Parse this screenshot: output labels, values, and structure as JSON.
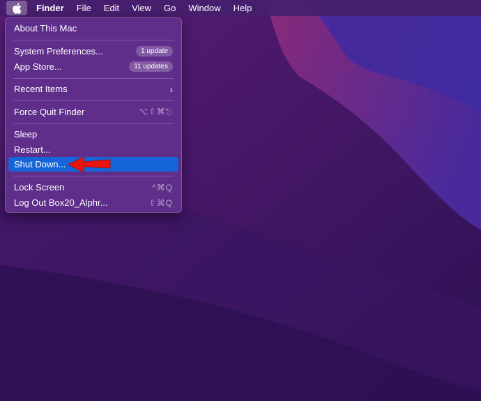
{
  "menubar": {
    "apple_icon": "apple-icon",
    "items": [
      "Finder",
      "File",
      "Edit",
      "View",
      "Go",
      "Window",
      "Help"
    ]
  },
  "apple_menu": {
    "about": "About This Mac",
    "system_preferences": {
      "label": "System Preferences...",
      "badge": "1 update"
    },
    "app_store": {
      "label": "App Store...",
      "badge": "11 updates"
    },
    "recent_items": {
      "label": "Recent Items",
      "icon": "chevron-right-icon"
    },
    "force_quit": {
      "label": "Force Quit Finder",
      "shortcut": "⌥⇧⌘⎋"
    },
    "sleep": "Sleep",
    "restart": "Restart...",
    "shut_down": "Shut Down...",
    "lock_screen": {
      "label": "Lock Screen",
      "shortcut": "^⌘Q"
    },
    "log_out": {
      "label": "Log Out Box20_Alphr...",
      "shortcut": "⇧⌘Q"
    }
  },
  "annotation": {
    "icon": "red-arrow-icon",
    "color": "#e8140d"
  },
  "colors": {
    "selection": "#1565d8",
    "menu_background": "#60308c",
    "desktop": "#2a1151"
  }
}
